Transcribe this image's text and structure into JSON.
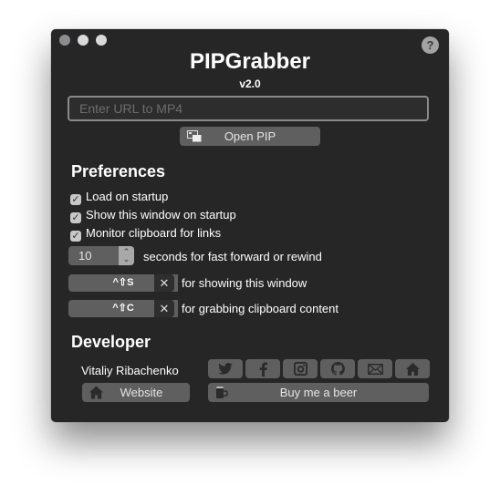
{
  "window": {
    "title": "PIPGrabber",
    "version": "v2.0",
    "help_label": "?"
  },
  "url_input": {
    "placeholder": "Enter URL to MP4",
    "value": ""
  },
  "open_pip_label": "Open PIP",
  "preferences": {
    "heading": "Preferences",
    "checkboxes": [
      {
        "label": "Load on startup",
        "checked": true
      },
      {
        "label": "Show this window on startup",
        "checked": true
      },
      {
        "label": "Monitor clipboard for links",
        "checked": true
      }
    ],
    "seek_seconds": {
      "value": "10",
      "label": "seconds for fast forward or rewind"
    },
    "shortcuts": [
      {
        "keys": "^⇧S",
        "clear": "✕",
        "label": "for showing this window"
      },
      {
        "keys": "^⇧C",
        "clear": "✕",
        "label": "for grabbing clipboard content"
      }
    ]
  },
  "developer": {
    "heading": "Developer",
    "name": "Vitaliy Ribachenko",
    "social_icons": [
      "twitter-icon",
      "facebook-icon",
      "instagram-icon",
      "github-icon",
      "mail-icon",
      "home-icon"
    ],
    "website_label": "Website",
    "beer_label": "Buy me a beer"
  },
  "colors": {
    "window_bg": "#262626",
    "button_bg": "#5f5f5f",
    "text": "#ffffff"
  }
}
